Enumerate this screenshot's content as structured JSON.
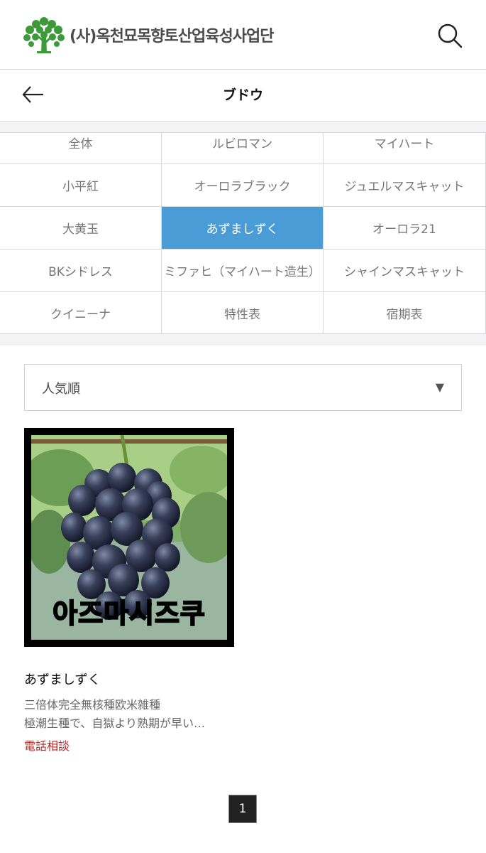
{
  "header": {
    "logo_text": "(사)옥천묘목향토산업육성사업단",
    "icons": {
      "logo": "tree-logo-icon",
      "search": "search-icon"
    },
    "colors": {
      "logo_green": "#3c9a3a",
      "logo_text": "#4b4b4b"
    }
  },
  "titlebar": {
    "title": "ブドウ",
    "icons": {
      "back": "arrow-left-icon"
    }
  },
  "categories": [
    "全体",
    "ルビロマン",
    "マイハート",
    "小平紅",
    "オーロラブラック",
    "ジュエルマスキャット",
    "大黄玉",
    "あずましずく",
    "オーロラ21",
    "BKシドレス",
    "ミファヒ（マイハート造生）",
    "シャインマスキャット",
    "クイニーナ",
    "特性表",
    "宿期表"
  ],
  "active_category": "あずましずく",
  "colors": {
    "active_category_bg": "#4a9cd6",
    "price_red": "#b5282a"
  },
  "sort": {
    "selected": "人気順",
    "icon": "dropdown-triangle-icon"
  },
  "product": {
    "image_caption": "아즈마시즈쿠",
    "name": "あずましずく",
    "desc_line1": "三倍体完全無核種欧米雑種",
    "desc_line2": "極潮生種で、自獄より熟期が早い…",
    "price": "電話相談"
  },
  "pagination": {
    "current": "1"
  }
}
